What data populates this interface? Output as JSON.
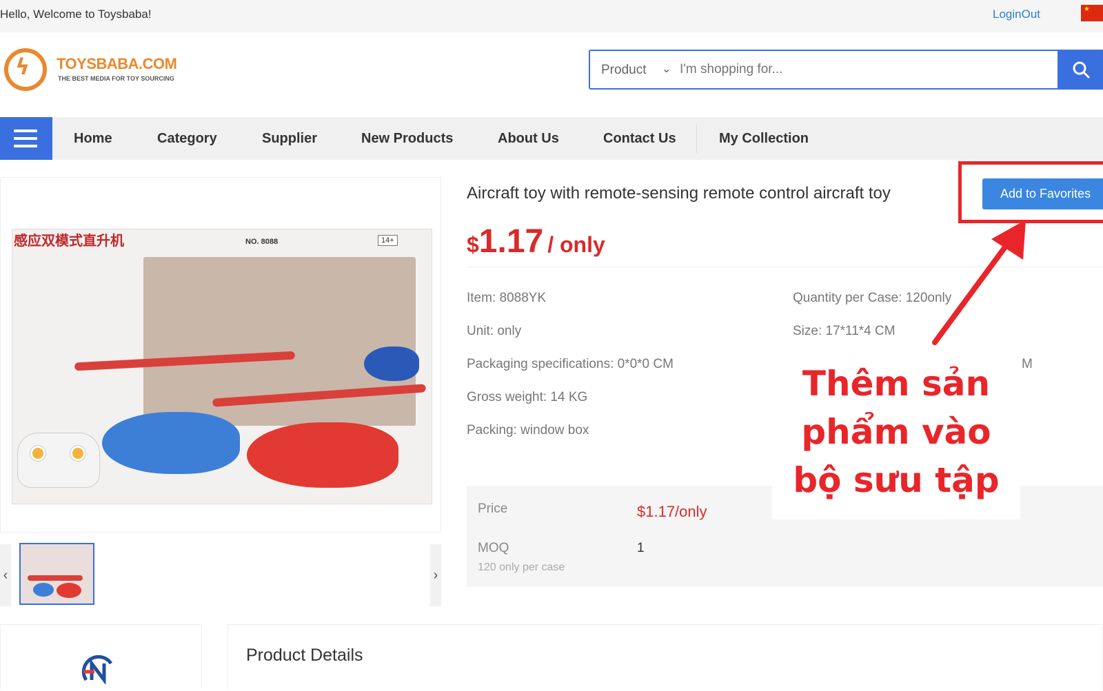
{
  "topbar": {
    "welcome": "Hello, Welcome to Toysbaba!",
    "login": "LoginOut"
  },
  "logo": {
    "name": "TOYSBABA.COM",
    "tagline": "THE BEST MEDIA FOR TOY SOURCING"
  },
  "search": {
    "category": "Product",
    "placeholder": "I'm shopping for..."
  },
  "nav": {
    "items": [
      "Home",
      "Category",
      "Supplier",
      "New Products",
      "About Us",
      "Contact Us",
      "My Collection"
    ]
  },
  "image_text": {
    "cn_title": "感应双模式直升机",
    "model_no": "NO. 8088",
    "age": "14+"
  },
  "product": {
    "title": "Aircraft toy with remote-sensing remote control aircraft toy",
    "favorites_label": "Add to Favorites",
    "price_currency": "$",
    "price_value": "1.17",
    "price_unit": "/ only",
    "specs_left": [
      "Item: 8088YK",
      "Unit: only",
      "Packaging specifications: 0*0*0 CM",
      "Gross weight: 14 KG",
      "Packing: window box"
    ],
    "specs_right": [
      "Quantity per Case: 120only",
      "Size: 17*11*4 CM"
    ],
    "spec_cut": "M"
  },
  "price_table": {
    "price_label": "Price",
    "price_value": "$1.17/only",
    "moq_label": "MOQ",
    "moq_sub": "120 only per case",
    "moq_value": "1"
  },
  "annotation": {
    "text": "Thêm sản phẩm vào bộ sưu tập",
    "color": "#e8262a"
  },
  "details": {
    "title": "Product Details"
  },
  "colors": {
    "accent": "#3a6fe0",
    "price": "#d92a2a",
    "brand": "#e8892f"
  }
}
